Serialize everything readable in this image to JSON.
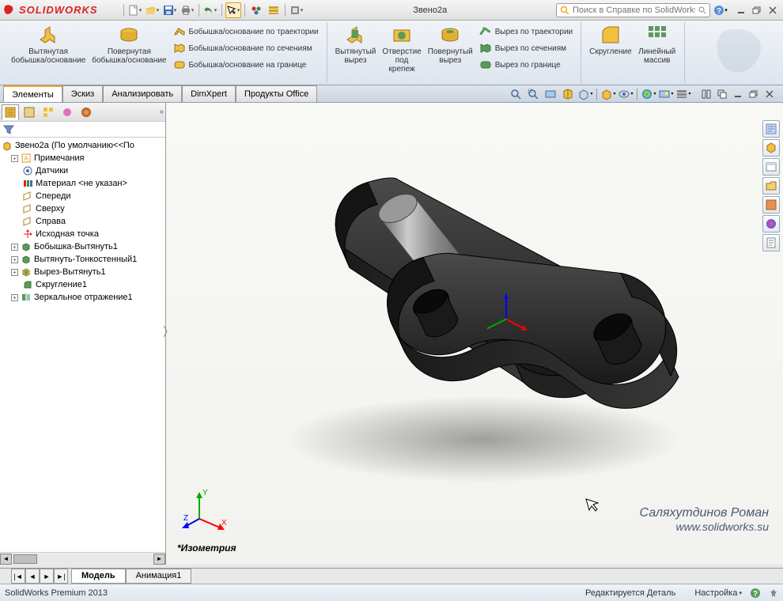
{
  "app": {
    "name": "SOLIDWORKS",
    "title": "Звено2а"
  },
  "search": {
    "placeholder": "Поиск в Справке по SolidWorks"
  },
  "qat_icons": [
    "new-icon",
    "open-icon",
    "save-icon",
    "print-icon",
    "undo-icon",
    "select-icon",
    "rebuild-icon",
    "options-icon",
    "record-icon"
  ],
  "ribbon": {
    "groups": [
      {
        "big": [
          {
            "icon": "extrude-boss-icon",
            "label": "Вытянутая\nбобышка/основание",
            "name": "extrude-boss-button"
          },
          {
            "icon": "revolve-boss-icon",
            "label": "Повернутая\nбобышка/основание",
            "name": "revolve-boss-button"
          }
        ],
        "small": [
          {
            "icon": "swept-boss-icon",
            "label": "Бобышка/основание по траектории",
            "name": "swept-boss-button"
          },
          {
            "icon": "loft-boss-icon",
            "label": "Бобышка/основание по сечениям",
            "name": "loft-boss-button"
          },
          {
            "icon": "boundary-boss-icon",
            "label": "Бобышка/основание на границе",
            "name": "boundary-boss-button"
          }
        ]
      },
      {
        "big": [
          {
            "icon": "extrude-cut-icon",
            "label": "Вытянутый\nвырез",
            "name": "extrude-cut-button"
          },
          {
            "icon": "hole-wizard-icon",
            "label": "Отверстие\nпод\nкрепеж",
            "name": "hole-wizard-button"
          },
          {
            "icon": "revolve-cut-icon",
            "label": "Повернутый\nвырез",
            "name": "revolve-cut-button"
          }
        ],
        "small": [
          {
            "icon": "swept-cut-icon",
            "label": "Вырез по траектории",
            "name": "swept-cut-button"
          },
          {
            "icon": "loft-cut-icon",
            "label": "Вырез по сечениям",
            "name": "loft-cut-button"
          },
          {
            "icon": "boundary-cut-icon",
            "label": "Вырез по границе",
            "name": "boundary-cut-button"
          }
        ]
      },
      {
        "big": [
          {
            "icon": "fillet-icon",
            "label": "Скругление",
            "name": "fillet-button"
          },
          {
            "icon": "pattern-icon",
            "label": "Линейный\nмассив",
            "name": "linear-pattern-button"
          }
        ],
        "small": []
      }
    ]
  },
  "tabs": [
    {
      "label": "Элементы",
      "active": true,
      "name": "tab-features"
    },
    {
      "label": "Эскиз",
      "active": false,
      "name": "tab-sketch"
    },
    {
      "label": "Анализировать",
      "active": false,
      "name": "tab-analyze"
    },
    {
      "label": "DimXpert",
      "active": false,
      "name": "tab-dimxpert"
    },
    {
      "label": "Продукты Office",
      "active": false,
      "name": "tab-office"
    }
  ],
  "view_toolbar_icons": [
    "zoom-fit-icon",
    "zoom-area-icon",
    "previous-view-icon",
    "section-view-icon",
    "display-style-icon",
    "hide-show-icon",
    "edit-appearance-icon",
    "scene-icon",
    "view-settings-icon"
  ],
  "tree_tabs": [
    "feature-manager-icon",
    "property-manager-icon",
    "config-manager-icon",
    "dimxpert-manager-icon",
    "display-manager-icon"
  ],
  "tree": {
    "root": "Звено2а  (По умолчанию<<По",
    "nodes": [
      {
        "icon": "annotations-icon",
        "label": "Примечания",
        "expand": "+",
        "name": "tree-annotations"
      },
      {
        "icon": "sensors-icon",
        "label": "Датчики",
        "name": "tree-sensors"
      },
      {
        "icon": "material-icon",
        "label": "Материал <не указан>",
        "name": "tree-material"
      },
      {
        "icon": "plane-icon",
        "label": "Спереди",
        "name": "tree-front-plane"
      },
      {
        "icon": "plane-icon",
        "label": "Сверху",
        "name": "tree-top-plane"
      },
      {
        "icon": "plane-icon",
        "label": "Справа",
        "name": "tree-right-plane"
      },
      {
        "icon": "origin-icon",
        "label": "Исходная точка",
        "name": "tree-origin"
      },
      {
        "icon": "boss-feature-icon",
        "label": "Бобышка-Вытянуть1",
        "expand": "+",
        "name": "tree-feature-1"
      },
      {
        "icon": "boss-feature-icon",
        "label": "Вытянуть-Тонкостенный1",
        "expand": "+",
        "name": "tree-feature-2"
      },
      {
        "icon": "cut-feature-icon",
        "label": "Вырез-Вытянуть1",
        "expand": "+",
        "name": "tree-feature-3"
      },
      {
        "icon": "fillet-feature-icon",
        "label": "Скругление1",
        "name": "tree-feature-4"
      },
      {
        "icon": "mirror-feature-icon",
        "label": "Зеркальное отражение1",
        "expand": "+",
        "name": "tree-feature-5"
      }
    ]
  },
  "viewport": {
    "iso_label": "Изометрия",
    "watermark_line1": "Саляхутдинов Роман",
    "watermark_line2": "www.solidworks.su"
  },
  "taskpane_icons": [
    "sw-resources-icon",
    "design-library-icon",
    "file-explorer-icon",
    "view-palette-icon",
    "appearances-icon",
    "custom-props-icon",
    "forum-icon"
  ],
  "bottom_tabs": [
    {
      "label": "Модель",
      "active": true,
      "name": "btab-model"
    },
    {
      "label": "Анимация1",
      "active": false,
      "name": "btab-animation"
    }
  ],
  "status": {
    "left": "SolidWorks Premium 2013",
    "mid": "Редактируется Деталь",
    "right": "Настройка"
  },
  "colors": {
    "brand": "#d22",
    "accent": "#f5a623",
    "panel": "#dde5ee"
  }
}
